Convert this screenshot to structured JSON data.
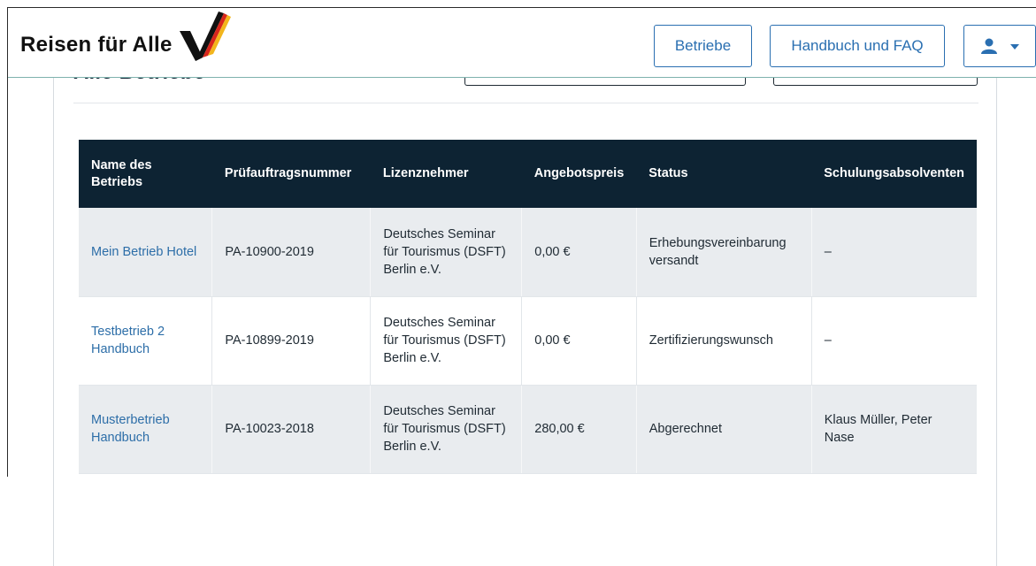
{
  "header": {
    "logo_text": "Reisen für Alle",
    "buttons": {
      "betriebe": "Betriebe",
      "handbuch": "Handbuch und FAQ"
    }
  },
  "page": {
    "title": "Alle Betriebe"
  },
  "table": {
    "headers": [
      "Name des Betriebs",
      "Prüfauftragsnummer",
      "Lizenznehmer",
      "Angebotspreis",
      "Status",
      "Schulungsabsolventen"
    ],
    "rows": [
      [
        "Mein Betrieb Hotel",
        "PA-10900-2019",
        "Deutsches Seminar für Tourismus (DSFT) Berlin e.V.",
        "0,00 €",
        "Erhebungsvereinbarung versandt",
        "–"
      ],
      [
        "Testbetrieb 2 Handbuch",
        "PA-10899-2019",
        "Deutsches Seminar für Tourismus (DSFT) Berlin e.V.",
        "0,00 €",
        "Zertifizierungswunsch",
        "–"
      ],
      [
        "Musterbetrieb Handbuch",
        "PA-10023-2018",
        "Deutsches Seminar für Tourismus (DSFT) Berlin e.V.",
        "280,00 €",
        "Abgerechnet",
        "Klaus Müller, Peter Nase"
      ]
    ]
  },
  "colors": {
    "accent": "#2a6fb1",
    "table_header_bg": "#0d2333",
    "alt_row_bg": "#e9ecef",
    "logo_black": "#111111",
    "logo_red": "#d8261c",
    "logo_gold": "#f2b51c"
  },
  "icons": {
    "user": "user-icon",
    "dropdown": "caret-down-icon"
  }
}
